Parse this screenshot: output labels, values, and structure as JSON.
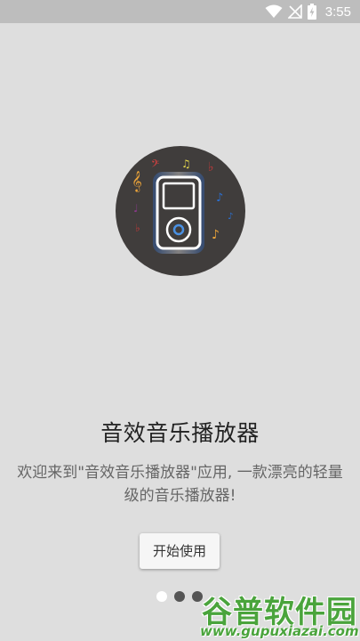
{
  "status_bar": {
    "time": "3:55",
    "icons": [
      "wifi-icon",
      "signal-off-icon",
      "battery-charging-icon"
    ]
  },
  "hero": {
    "icon": "music-player-icon",
    "circle_color": "#403d3c"
  },
  "intro": {
    "title": "音效音乐播放器",
    "description": "欢迎来到\"音效音乐播放器\"应用, 一款漂亮的轻量级的音乐播放器!",
    "start_button_label": "开始使用"
  },
  "pager": {
    "page_count": 3,
    "active_index": 0
  },
  "watermark": {
    "title": "谷普软件园",
    "url": "www.gupuxiazai.com",
    "color": "#4aa43c"
  }
}
